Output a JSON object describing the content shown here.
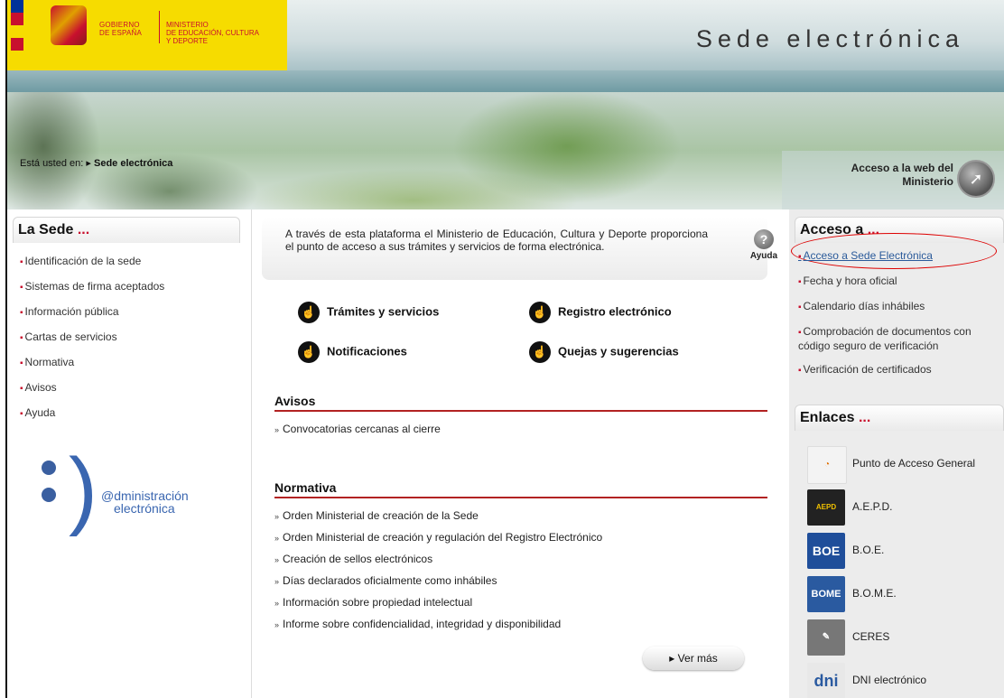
{
  "header": {
    "gov_line1": "GOBIERNO",
    "gov_line2": "DE ESPAÑA",
    "min_line1": "MINISTERIO",
    "min_line2": "DE EDUCACIÓN, CULTURA",
    "min_line3": "Y DEPORTE",
    "site_title": "Sede electrónica",
    "breadcrumb_prefix": "Está usted en:",
    "breadcrumb_current": "Sede electrónica",
    "ministry_link_line1": "Acceso a la web del",
    "ministry_link_line2": "Ministerio"
  },
  "left": {
    "title": "La Sede",
    "title_dots": "...",
    "items": [
      {
        "label": "Identificación de la sede"
      },
      {
        "label": "Sistemas de firma aceptados"
      },
      {
        "label": "Información pública"
      },
      {
        "label": "Cartas de servicios"
      },
      {
        "label": "Normativa"
      },
      {
        "label": "Avisos"
      },
      {
        "label": "Ayuda"
      }
    ],
    "logo_line1": "@dministración",
    "logo_line2": "electrónica"
  },
  "center": {
    "intro": "A través de esta plataforma el Ministerio de Educación, Cultura y Deporte proporciona el punto de acceso a sus trámites y servicios de forma electrónica.",
    "help_label": "Ayuda",
    "services": {
      "tramites": "Trámites y servicios",
      "registro": "Registro electrónico",
      "notificaciones": "Notificaciones",
      "quejas": "Quejas y sugerencias"
    },
    "avisos": {
      "title": "Avisos",
      "items": [
        "Convocatorias cercanas al cierre"
      ]
    },
    "normativa": {
      "title": "Normativa",
      "items": [
        "Orden Ministerial de creación de la Sede",
        "Orden Ministerial de creación y regulación del Registro Electrónico",
        "Creación de sellos electrónicos",
        "Días declarados oficialmente como inhábiles",
        "Información sobre propiedad intelectual",
        "Informe sobre confidencialidad, integridad y disponibilidad"
      ]
    },
    "ver_mas": "Ver más"
  },
  "right": {
    "acceso_title": "Acceso a",
    "acceso_dots": "...",
    "acceso_items": [
      "Acceso a Sede Electrónica",
      "Fecha y hora oficial",
      "Calendario días inhábiles",
      "Comprobación de documentos con código seguro de verificación",
      "Verificación de certificados"
    ],
    "enlaces_title": "Enlaces",
    "enlaces_dots": "...",
    "enlaces": {
      "pag": "Punto de Acceso General",
      "aepd": "A.E.P.D.",
      "boe": "B.O.E.",
      "bome": "B.O.M.E.",
      "ceres": "CERES",
      "dni": "DNI electrónico"
    },
    "logo_texts": {
      "boe": "BOE",
      "bome": "BOME",
      "dni": "dni"
    }
  }
}
